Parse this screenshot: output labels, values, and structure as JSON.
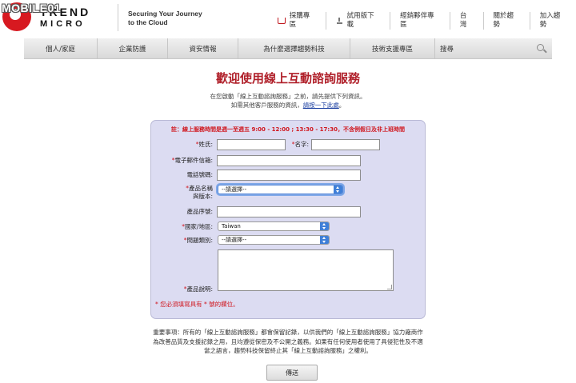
{
  "watermark": "MOBILE01",
  "brand": {
    "line1": "TREND",
    "line2": "MICRO"
  },
  "tagline": {
    "line1": "Securing Your Journey",
    "line2": "to the Cloud"
  },
  "top_links": [
    "採購專區",
    "試用版下載",
    "經銷夥伴專區",
    "台灣",
    "關於趨勢",
    "加入趨勢"
  ],
  "nav": {
    "items": [
      "個人/家庭",
      "企業防護",
      "資安情報",
      "為什麼選擇趨勢科技",
      "技術支援專區"
    ],
    "search_label": "搜尋"
  },
  "page_title": "歡迎使用線上互動諮詢服務",
  "intro": {
    "line1": "在您啟動「線上互動諮詢服務」之前，請先提供下列資訊。",
    "line2_prefix": "如需其他客戶服務的資訊，",
    "line2_link": "請按一下此處",
    "line2_suffix": "。"
  },
  "hours_notice": "註：線上服務時間是週一至週五 9:00 - 12:00 ; 13:30 - 17:30，不含例假日及非上班時間",
  "form": {
    "required_mark": "*",
    "last_name_label": "姓氏:",
    "first_name_label": "名字:",
    "email_label": "電子郵件信箱:",
    "phone_label": "電話號碼:",
    "product_label_1": "產品名稱",
    "product_label_2": "與版本:",
    "product_value": "--請選擇--",
    "serial_label": "產品序號:",
    "country_label": "國家/地區:",
    "country_value": "Taiwan",
    "category_label": "問題類別:",
    "category_value": "--請選擇--",
    "description_label": "產品說明:",
    "required_note": "* 您必須填寫具有 * 號的欄位。"
  },
  "notice": {
    "line1": "重要事項：所有的「線上互動諮詢服務」都會保留記錄，以供我們的「線上互動諮詢服務」協力廠商作",
    "line2": "為改善品質及支援記錄之用，且均遵從保密及不公開之義務。如果有任何使用者使用了具侵犯性及不適",
    "line3": "當之語言，趨勢科技保留終止其「線上互動諮詢服務」之權利。"
  },
  "submit_label": "傳送",
  "colors": {
    "title_red": "#b0202a",
    "accent_red": "#d0161e",
    "form_bg": "#dcdcf2",
    "select_blue": "#3f7fd8"
  }
}
